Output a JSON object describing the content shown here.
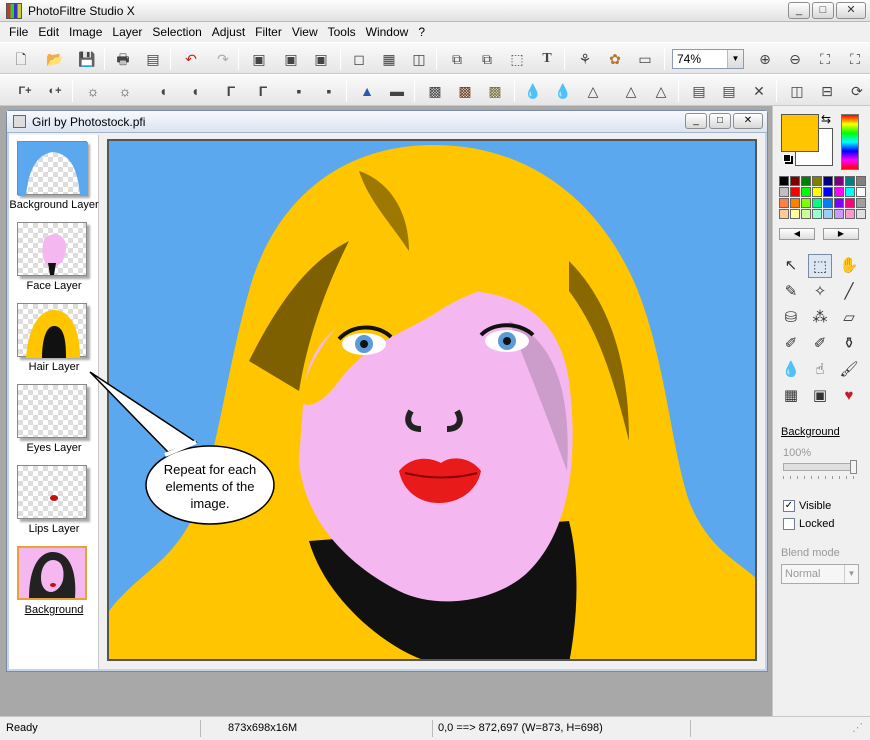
{
  "app": {
    "title": "PhotoFiltre Studio X"
  },
  "menu": [
    "File",
    "Edit",
    "Image",
    "Layer",
    "Selection",
    "Adjust",
    "Filter",
    "View",
    "Tools",
    "Window",
    "?"
  ],
  "toolbar": {
    "zoom": "74%"
  },
  "document": {
    "title": "Girl by Photostock.pfi",
    "layers": [
      {
        "label": "Background Layer"
      },
      {
        "label": "Face Layer"
      },
      {
        "label": "Hair Layer"
      },
      {
        "label": "Eyes Layer"
      },
      {
        "label": "Lips Layer"
      },
      {
        "label": "Background",
        "active": true
      }
    ]
  },
  "callout": {
    "line1": "Repeat for each",
    "line2": "elements of the",
    "line3": "image."
  },
  "tools_panel": {
    "colors": {
      "foreground": "#ffc600",
      "background": "#ffffff"
    },
    "layer_name": "Background",
    "opacity_label": "100%",
    "opacity_value": 100,
    "visible_label": "Visible",
    "visible_checked": true,
    "locked_label": "Locked",
    "locked_checked": false,
    "blend_label": "Blend mode",
    "blend_value": "Normal"
  },
  "status": {
    "state": "Ready",
    "image_info": "873x698x16M",
    "coords": "0,0 ==> 872,697 (W=873, H=698)"
  }
}
